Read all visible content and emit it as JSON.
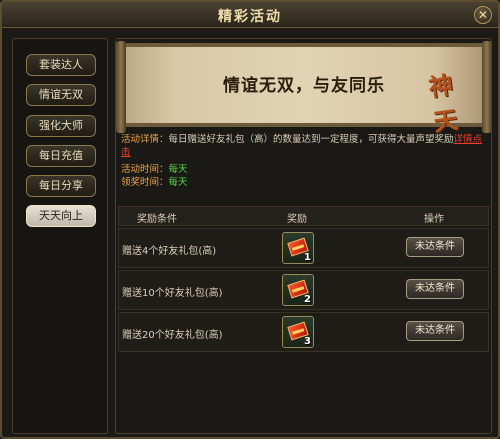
{
  "window": {
    "title": "精彩活动",
    "close_glyph": "✕"
  },
  "sidebar": {
    "items": [
      {
        "label": "套装达人",
        "active": false
      },
      {
        "label": "情谊无双",
        "active": false
      },
      {
        "label": "强化大师",
        "active": false
      },
      {
        "label": "每日充值",
        "active": false
      },
      {
        "label": "每日分享",
        "active": false
      },
      {
        "label": "天天向上",
        "active": true
      }
    ]
  },
  "banner": {
    "slogan": "情谊无双，与友同乐",
    "logo_text": "神天"
  },
  "info": {
    "detail_label": "活动详情：",
    "detail_text": "每日赠送好友礼包（高）的数量达到一定程度，可获得大量声望奖励",
    "detail_link": "详情点击",
    "activity_time_label": "活动时间：",
    "activity_time_value": "每天",
    "claim_time_label": "领奖时间：",
    "claim_time_value": "每天"
  },
  "table": {
    "headers": {
      "condition": "奖励条件",
      "reward": "奖励",
      "action": "操作"
    },
    "rows": [
      {
        "condition": "赠送4个好友礼包(高)",
        "reward_icon": "red-gift-packet-icon",
        "reward_count": "1",
        "action": "未达条件"
      },
      {
        "condition": "赠送10个好友礼包(高)",
        "reward_icon": "red-gift-packet-icon",
        "reward_count": "2",
        "action": "未达条件"
      },
      {
        "condition": "赠送20个好友礼包(高)",
        "reward_icon": "red-gift-packet-icon",
        "reward_count": "3",
        "action": "未达条件"
      }
    ]
  },
  "colors": {
    "accent": "#f0a54a",
    "time_green": "#5bd44d",
    "link_red": "#f03c2e"
  }
}
